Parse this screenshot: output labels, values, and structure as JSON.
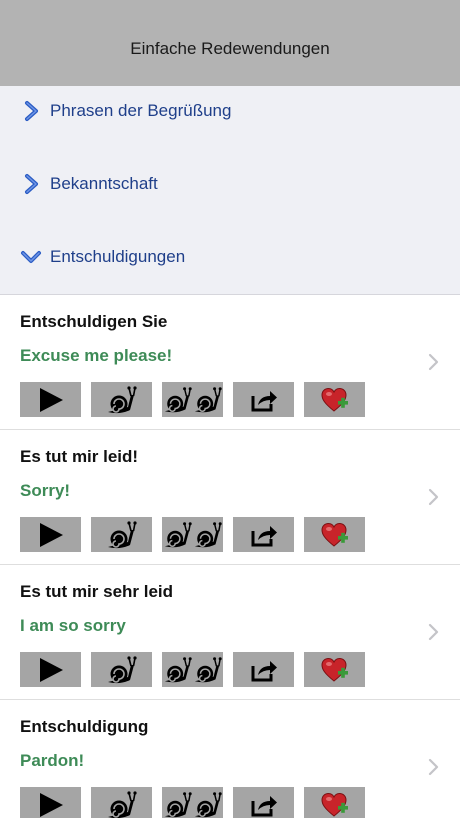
{
  "navbar": {
    "title": "Einfache Redewendungen"
  },
  "categories": [
    {
      "label": "Phrasen der Begrüßung",
      "expanded": false,
      "icon": "chevron-right-icon"
    },
    {
      "label": "Bekanntschaft",
      "expanded": false,
      "icon": "chevron-right-icon"
    },
    {
      "label": "Entschuldigungen",
      "expanded": true,
      "icon": "chevron-down-icon"
    }
  ],
  "phrases": [
    {
      "german": "Entschuldigen Sie",
      "english": "Excuse me please!"
    },
    {
      "german": "Es tut mir leid!",
      "english": "Sorry!"
    },
    {
      "german": "Es tut mir sehr leid",
      "english": "I am so sorry"
    },
    {
      "german": "Entschuldigung",
      "english": "Pardon!"
    }
  ],
  "buttons": [
    "play-icon",
    "snail-icon",
    "double-snail-icon",
    "share-icon",
    "heart-plus-icon"
  ],
  "colors": {
    "navbar": "#b3b3b3",
    "category_bg": "#eff0f5",
    "category_text": "#1f3f8a",
    "english_text": "#3e8b57",
    "button_bg": "#a5a5a5",
    "heart": "#c8242a",
    "plus": "#3a9a3a"
  }
}
